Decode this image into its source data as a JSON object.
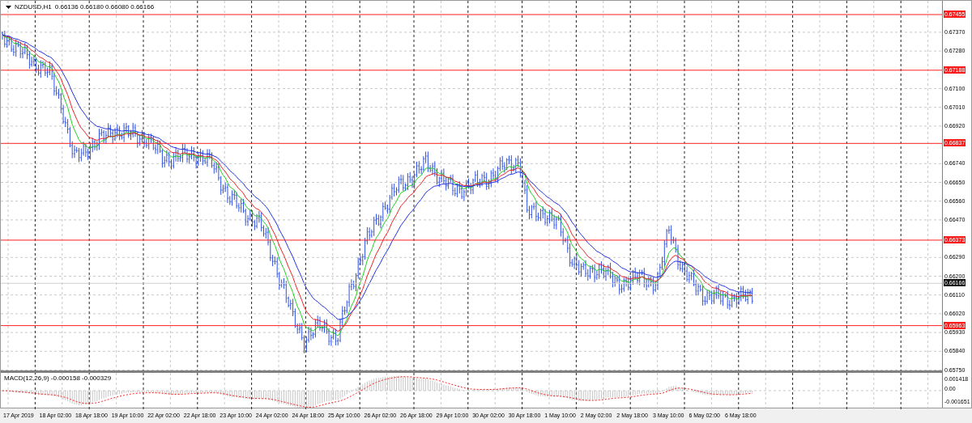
{
  "chart": {
    "symbol": "NZDUSD,H1",
    "quote": "0.66136 0.66180 0.66080 0.66166"
  },
  "price_axis": [
    {
      "label": "0.67455",
      "kind": "level"
    },
    {
      "label": "0.67370",
      "kind": "tick"
    },
    {
      "label": "0.67280",
      "kind": "tick"
    },
    {
      "label": "0.67188",
      "kind": "level"
    },
    {
      "label": "0.67100",
      "kind": "tick"
    },
    {
      "label": "0.67010",
      "kind": "tick"
    },
    {
      "label": "0.66920",
      "kind": "tick"
    },
    {
      "label": "0.66837",
      "kind": "level"
    },
    {
      "label": "0.66740",
      "kind": "tick"
    },
    {
      "label": "0.66650",
      "kind": "tick"
    },
    {
      "label": "0.66560",
      "kind": "tick"
    },
    {
      "label": "0.66470",
      "kind": "tick"
    },
    {
      "label": "0.66373",
      "kind": "level"
    },
    {
      "label": "0.66290",
      "kind": "tick"
    },
    {
      "label": "0.66200",
      "kind": "tick"
    },
    {
      "label": "0.66166",
      "kind": "current"
    },
    {
      "label": "0.66110",
      "kind": "tick"
    },
    {
      "label": "0.66020",
      "kind": "tick"
    },
    {
      "label": "0.65963",
      "kind": "level"
    },
    {
      "label": "0.65930",
      "kind": "tick"
    },
    {
      "label": "0.65840",
      "kind": "tick"
    },
    {
      "label": "0.65750",
      "kind": "tick"
    }
  ],
  "macd": {
    "label": "MACD(12,26,9) -0.000158 -0.000329",
    "axis": [
      "0.001418",
      "0.00",
      "-0.001651"
    ]
  },
  "time_axis": [
    "17 Apr 2019",
    "18 Apr 02:00",
    "18 Apr 18:00",
    "19 Apr 10:00",
    "22 Apr 02:00",
    "22 Apr 18:00",
    "23 Apr 10:00",
    "24 Apr 02:00",
    "24 Apr 18:00",
    "25 Apr 10:00",
    "26 Apr 02:00",
    "26 Apr 18:00",
    "29 Apr 10:00",
    "30 Apr 02:00",
    "30 Apr 18:00",
    "1 May 10:00",
    "2 May 02:00",
    "2 May 18:00",
    "3 May 10:00",
    "6 May 02:00",
    "6 May 18:00"
  ]
}
